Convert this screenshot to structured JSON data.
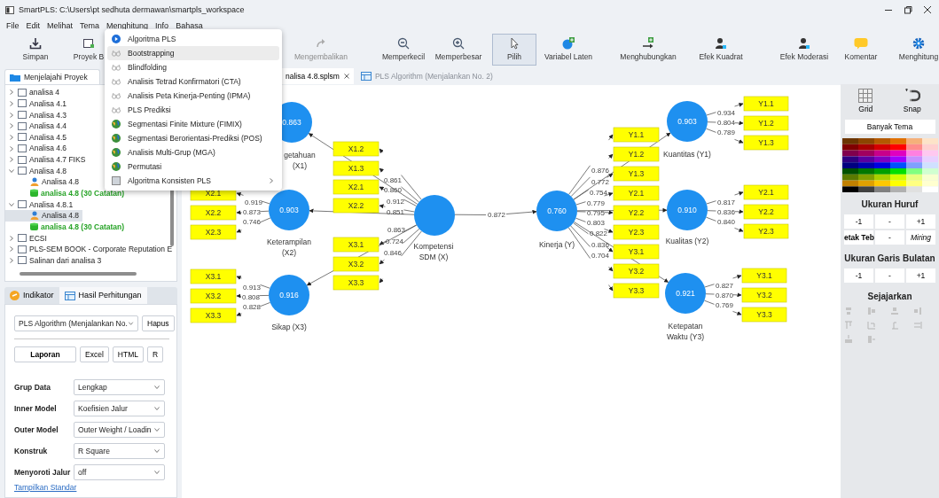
{
  "window": {
    "title": "SmartPLS: C:\\Users\\pt sedhuta dermawan\\smartpls_workspace"
  },
  "menu_bar": [
    "File",
    "Edit",
    "Melihat",
    "Tema",
    "Menghitung",
    "Info",
    "Bahasa"
  ],
  "toolbar": {
    "items": [
      {
        "label": "Simpan",
        "kind": "save",
        "selected": false,
        "disabled": false
      },
      {
        "label": "Proyek B",
        "kind": "new",
        "selected": false,
        "disabled": false
      },
      {
        "label": "Mengembalikan",
        "kind": "redo",
        "selected": false,
        "disabled": true
      },
      {
        "label": "Memperkecil",
        "kind": "zoom-out",
        "selected": false,
        "disabled": false
      },
      {
        "label": "Memperbesar",
        "kind": "zoom-in",
        "selected": false,
        "disabled": false
      },
      {
        "label": "Pilih",
        "kind": "pointer",
        "selected": true,
        "disabled": false
      },
      {
        "label": "Variabel Laten",
        "kind": "latent",
        "selected": false,
        "disabled": false
      },
      {
        "label": "Menghubungkan",
        "kind": "connect",
        "selected": false,
        "disabled": false
      },
      {
        "label": "Efek Kuadrat",
        "kind": "person",
        "selected": false,
        "disabled": false
      },
      {
        "label": "Efek Moderasi",
        "kind": "person",
        "selected": false,
        "disabled": false
      },
      {
        "label": "Komentar",
        "kind": "comment",
        "selected": false,
        "disabled": false
      },
      {
        "label": "Menghitung",
        "kind": "calculate",
        "selected": false,
        "disabled": false
      }
    ]
  },
  "open_menu": {
    "items": [
      {
        "label": "Algoritma PLS",
        "kind": "run",
        "selected": false,
        "submenu": false
      },
      {
        "label": "Bootstrapping",
        "kind": "glasses",
        "selected": true,
        "submenu": false
      },
      {
        "label": "Blindfolding",
        "kind": "glasses",
        "selected": false,
        "submenu": false
      },
      {
        "label": "Analisis Tetrad Konfirmatori (CTA)",
        "kind": "glasses",
        "selected": false,
        "submenu": false
      },
      {
        "label": "Analisis Peta Kinerja-Penting (IPMA)",
        "kind": "glasses",
        "selected": false,
        "submenu": false
      },
      {
        "label": "PLS Prediksi",
        "kind": "glasses",
        "selected": false,
        "submenu": false
      },
      {
        "label": "Segmentasi Finite Mixture (FIMIX)",
        "kind": "globe",
        "selected": false,
        "submenu": false
      },
      {
        "label": "Segmentasi Berorientasi-Prediksi (POS)",
        "kind": "globe",
        "selected": false,
        "submenu": false
      },
      {
        "label": "Analisis Multi-Grup (MGA)",
        "kind": "globe",
        "selected": false,
        "submenu": false
      },
      {
        "label": "Permutasi",
        "kind": "globe",
        "selected": false,
        "submenu": false
      },
      {
        "label": "Algoritma Konsisten PLS",
        "kind": "square",
        "selected": false,
        "submenu": true
      }
    ]
  },
  "explorer": {
    "tab": "Menjelajahi Proyek",
    "tree": [
      {
        "label": "analisa 4",
        "kind": "project",
        "expanded": false,
        "selected": false
      },
      {
        "label": "Analisa 4.1",
        "kind": "project",
        "expanded": false,
        "selected": false
      },
      {
        "label": "Analisa 4.3",
        "kind": "project",
        "expanded": false,
        "selected": false
      },
      {
        "label": "Analisa 4.4",
        "kind": "project",
        "expanded": false,
        "selected": false
      },
      {
        "label": "Analisa 4.5",
        "kind": "project",
        "expanded": false,
        "selected": false
      },
      {
        "label": "Analisa 4.6",
        "kind": "project",
        "expanded": false,
        "selected": false
      },
      {
        "label": "Analisa 4.7 FIKS",
        "kind": "project",
        "expanded": false,
        "selected": false
      },
      {
        "label": "Analisa 4.8",
        "kind": "project",
        "expanded": true,
        "selected": false,
        "children": [
          {
            "label": "Analisa 4.8",
            "kind": "model",
            "selected": false
          },
          {
            "label": "analisa 4.8 (30 Catatan)",
            "kind": "data",
            "selected": false
          }
        ]
      },
      {
        "label": "Analisa 4.8.1",
        "kind": "project",
        "expanded": true,
        "selected": false,
        "children": [
          {
            "label": "Analisa 4.8",
            "kind": "model",
            "selected": true
          },
          {
            "label": "analisa 4.8 (30 Catatan)",
            "kind": "data",
            "selected": false
          }
        ]
      },
      {
        "label": "ECSI",
        "kind": "project",
        "expanded": false,
        "selected": false
      },
      {
        "label": "PLS-SEM BOOK - Corporate Reputation E",
        "kind": "project",
        "expanded": false,
        "selected": false
      },
      {
        "label": "Salinan dari analisa 3",
        "kind": "project",
        "expanded": false,
        "selected": false
      }
    ]
  },
  "results_panel": {
    "tabs": [
      {
        "label": "Indikator",
        "kind": "indicator",
        "selected": false
      },
      {
        "label": "Hasil Perhitungan",
        "kind": "table",
        "selected": true
      }
    ],
    "run_select": "PLS Algorithm (Menjalankan No.",
    "clear_button": "Hapus",
    "export_buttons": [
      {
        "label": "Laporan",
        "kind": "primary"
      },
      {
        "label": "Excel",
        "kind": "plain"
      },
      {
        "label": "HTML",
        "kind": "plain"
      },
      {
        "label": "R",
        "kind": "plain"
      }
    ],
    "settings": [
      {
        "label": "Grup Data",
        "value": "Lengkap"
      },
      {
        "label": "Inner Model",
        "value": "Koefisien Jalur"
      },
      {
        "label": "Outer Model",
        "value": "Outer Weight / Loadin"
      },
      {
        "label": "Konstruk",
        "value": "R Square"
      },
      {
        "label": "Menyoroti Jalur",
        "value": "off"
      }
    ],
    "link": "Tampilkan Standar"
  },
  "editor_tabs": [
    {
      "label": "nalisa 4.8.splsm",
      "selected": true,
      "closable": true
    },
    {
      "label": "PLS Algorithm (Menjalankan No. 2)",
      "selected": false,
      "closable": false
    }
  ],
  "diagram": {
    "constructs": [
      {
        "label": [
          "getahuan",
          "(X1)"
        ],
        "value": "0.863"
      },
      {
        "label": [
          "Keterampilan",
          "(X2)"
        ],
        "value": "0.903"
      },
      {
        "label": [
          "Sikap (X3)"
        ],
        "value": "0.916"
      },
      {
        "label": [
          "Kompetensi",
          "SDM (X)"
        ]
      },
      {
        "label": [
          "Kinerja (Y)"
        ],
        "value": "0.760"
      },
      {
        "label": [
          "Kuantitas (Y1)"
        ],
        "value": "0.903"
      },
      {
        "label": [
          "Kualitas (Y2)"
        ],
        "value": "0.910"
      },
      {
        "label": [
          "Ketepatan",
          "Waktu (Y3)"
        ],
        "value": "0.921"
      }
    ],
    "indicator_groups": [
      [
        "X2.1",
        "X2.2",
        "X2.3"
      ],
      [
        "X3.1",
        "X3.2",
        "X3.3"
      ],
      [
        "X1.2",
        "X1.3",
        "X2.1",
        "X2.2",
        "X3.1",
        "X3.2",
        "X3.3"
      ],
      [
        "Y1.1",
        "Y1.2",
        "Y1.3",
        "Y2.1",
        "Y2.2",
        "Y2.3",
        "Y3.1",
        "Y3.2",
        "Y3.3"
      ],
      [
        "Y1.1",
        "Y1.2",
        "Y1.3"
      ],
      [
        "Y2.1",
        "Y2.2",
        "Y2.3"
      ],
      [
        "Y3.1",
        "Y3.2",
        "Y3.3"
      ]
    ],
    "loadings": [
      [
        "0.919",
        "0.873",
        "0.746"
      ],
      [
        "0.913",
        "0.808",
        "0.828"
      ],
      [
        "0.861",
        "0.860",
        "0.912",
        "0.851",
        "0.863",
        "0.724",
        "0.846"
      ],
      [
        "0.876",
        "0.772",
        "0.754",
        "0.779",
        "0.795",
        "0.803",
        "0.822",
        "0.836",
        "0.704"
      ],
      [
        "0.934",
        "0.804",
        "0.789"
      ],
      [
        "0.817",
        "0.836",
        "0.840"
      ],
      [
        "0.827",
        "0.870",
        "0.769"
      ]
    ],
    "path_coefficients": [
      "0.872"
    ]
  },
  "palette_panel": {
    "tools": [
      {
        "label": "Grid",
        "kind": "grid"
      },
      {
        "label": "Snap",
        "kind": "magnet"
      }
    ],
    "theme_button": "Banyak Tema",
    "sections": [
      {
        "title": "Ukuran Huruf",
        "rows": [
          [
            {
              "label": "-1",
              "kind": "plain"
            },
            {
              "label": "-",
              "kind": "plain"
            },
            {
              "label": "+1",
              "kind": "plain"
            }
          ],
          [
            {
              "label": "etak Teb",
              "kind": "bold"
            },
            {
              "label": "-",
              "kind": "plain"
            },
            {
              "label": "Miring",
              "kind": "italic"
            }
          ]
        ]
      },
      {
        "title": "Ukuran Garis Bulatan",
        "rows": [
          [
            {
              "label": "-1",
              "kind": "plain"
            },
            {
              "label": "-",
              "kind": "plain"
            },
            {
              "label": "+1",
              "kind": "plain"
            }
          ]
        ]
      },
      {
        "title": "Sejajarkan"
      }
    ]
  }
}
